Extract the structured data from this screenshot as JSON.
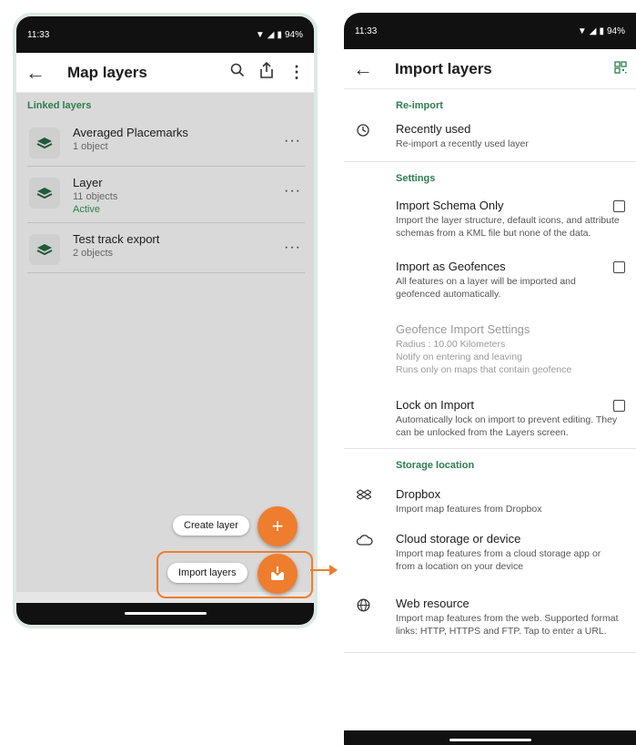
{
  "left": {
    "status": {
      "time": "11:33",
      "battery": "94%"
    },
    "title": "Map layers",
    "section_label": "Linked layers",
    "layers": [
      {
        "name": "Averaged Placemarks",
        "count": "1 object",
        "status": ""
      },
      {
        "name": "Layer",
        "count": "11 objects",
        "status": "Active"
      },
      {
        "name": "Test track export",
        "count": "2 objects",
        "status": ""
      }
    ],
    "create_layer_label": "Create layer",
    "import_layers_label": "Import layers"
  },
  "right": {
    "status": {
      "time": "11:33",
      "battery": "94%"
    },
    "title": "Import layers",
    "reimport_label": "Re-import",
    "recently_used": {
      "title": "Recently used",
      "sub": "Re-import a recently used layer"
    },
    "settings_label": "Settings",
    "import_schema": {
      "title": "Import Schema Only",
      "sub": "Import the layer structure, default icons, and attribute schemas from a KML file but none of the data."
    },
    "import_geofences": {
      "title": "Import as Geofences",
      "sub": "All features on a layer will be imported and geofenced automatically."
    },
    "geofence_settings": {
      "title": "Geofence Import Settings",
      "line1": "Radius : 10.00 Kilometers",
      "line2": "Notify on entering and leaving",
      "line3": "Runs only on maps that contain geofence"
    },
    "lock_import": {
      "title": "Lock on Import",
      "sub": "Automatically lock on import to prevent editing. They can be unlocked from the Layers screen."
    },
    "storage_label": "Storage location",
    "dropbox": {
      "title": "Dropbox",
      "sub": "Import map features from Dropbox"
    },
    "cloud": {
      "title": "Cloud storage or device",
      "sub": "Import map features from a cloud storage app or from a location on your device"
    },
    "web": {
      "title": "Web resource",
      "sub": "Import map features from the web. Supported format links: HTTP, HTTPS and FTP. Tap to enter a URL."
    }
  },
  "colors": {
    "accent": "#ef7d2e",
    "green": "#2e7d4f"
  }
}
